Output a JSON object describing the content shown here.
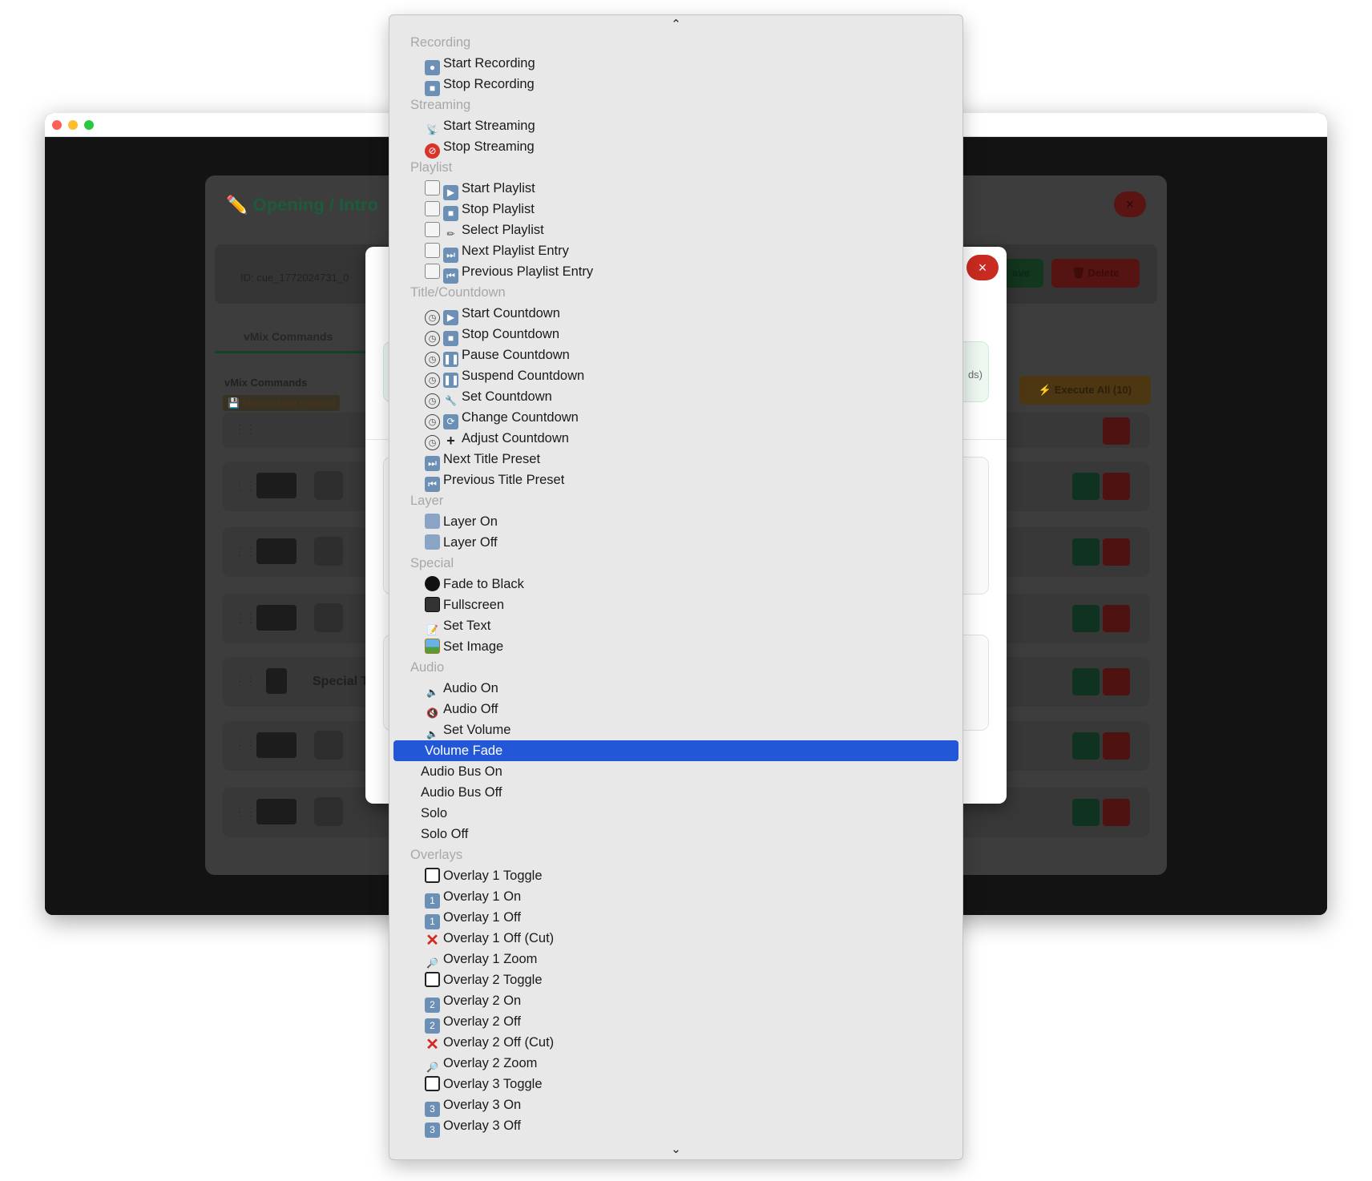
{
  "cue_editor": {
    "title": "✏️ Opening / Intro",
    "close_label": "×",
    "id_text": "ID: cue_1772024731_0",
    "save_label": "ave",
    "delete_label": "🗑 Delete",
    "tab_label": "vMix Commands",
    "section_title": "vMix Commands",
    "section_subtitle": "💾 Manual save required",
    "execute_all_label": "⚡ Execute All (10)",
    "row_special_text": "Special T"
  },
  "inner_modal": {
    "close_label": "×",
    "hint_suffix": "ds)"
  },
  "menu": {
    "scroll_up": "⌃",
    "scroll_down": "⌄",
    "groups": {
      "recording": "Recording",
      "streaming": "Streaming",
      "playlist": "Playlist",
      "title_countdown": "Title/Countdown",
      "layer": "Layer",
      "special": "Special",
      "audio": "Audio",
      "overlays": "Overlays"
    },
    "items": {
      "start_recording": "Start Recording",
      "stop_recording": "Stop Recording",
      "start_streaming": "Start Streaming",
      "stop_streaming": "Stop Streaming",
      "start_playlist": "Start Playlist",
      "stop_playlist": "Stop Playlist",
      "select_playlist": "Select Playlist",
      "next_playlist_entry": "Next Playlist Entry",
      "previous_playlist_entry": "Previous Playlist Entry",
      "start_countdown": "Start Countdown",
      "stop_countdown": "Stop Countdown",
      "pause_countdown": "Pause Countdown",
      "suspend_countdown": "Suspend Countdown",
      "set_countdown": "Set Countdown",
      "change_countdown": "Change Countdown",
      "adjust_countdown": "Adjust Countdown",
      "next_title_preset": "Next Title Preset",
      "previous_title_preset": "Previous Title Preset",
      "layer_on": "Layer On",
      "layer_off": "Layer Off",
      "fade_to_black": "Fade to Black",
      "fullscreen": "Fullscreen",
      "set_text": "Set Text",
      "set_image": "Set Image",
      "audio_on": "Audio On",
      "audio_off": "Audio Off",
      "set_volume": "Set Volume",
      "volume_fade": "Volume Fade",
      "audio_bus_on": "Audio Bus On",
      "audio_bus_off": "Audio Bus Off",
      "solo": "Solo",
      "solo_off": "Solo Off",
      "overlay_1_toggle": "Overlay 1 Toggle",
      "overlay_1_on": "Overlay 1 On",
      "overlay_1_off": "Overlay 1 Off",
      "overlay_1_off_cut": "Overlay 1 Off (Cut)",
      "overlay_1_zoom": "Overlay 1 Zoom",
      "overlay_2_toggle": "Overlay 2 Toggle",
      "overlay_2_on": "Overlay 2 On",
      "overlay_2_off": "Overlay 2 Off",
      "overlay_2_off_cut": "Overlay 2 Off (Cut)",
      "overlay_2_zoom": "Overlay 2 Zoom",
      "overlay_3_toggle": "Overlay 3 Toggle",
      "overlay_3_on": "Overlay 3 On",
      "overlay_3_off": "Overlay 3 Off"
    },
    "selected": "Volume Fade"
  }
}
